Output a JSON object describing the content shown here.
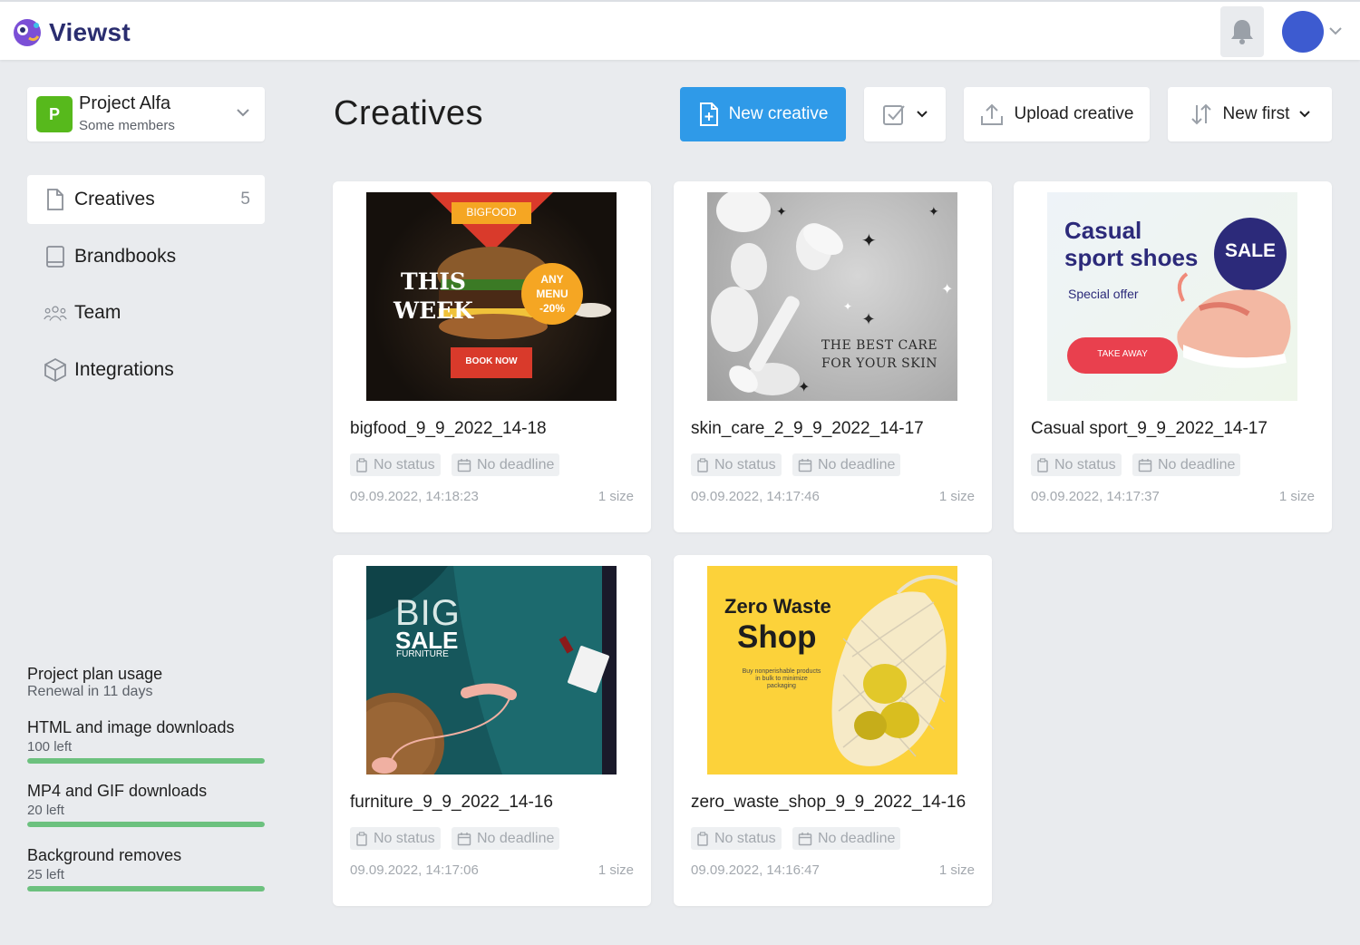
{
  "app": {
    "name": "Viewst"
  },
  "project": {
    "badge": "P",
    "name": "Project Alfa",
    "subtitle": "Some members"
  },
  "nav": {
    "items": [
      {
        "label": "Creatives",
        "count": "5",
        "icon": "file-icon"
      },
      {
        "label": "Brandbooks",
        "icon": "book-icon"
      },
      {
        "label": "Team",
        "icon": "team-icon"
      },
      {
        "label": "Integrations",
        "icon": "cube-icon"
      }
    ]
  },
  "usage": {
    "title": "Project plan usage",
    "renewal": "Renewal in 11 days",
    "items": [
      {
        "name": "HTML and image downloads",
        "left": "100 left",
        "fraction": 1.0
      },
      {
        "name": "MP4 and GIF downloads",
        "left": "20 left",
        "fraction": 1.0
      },
      {
        "name": "Background removes",
        "left": "25 left",
        "fraction": 1.0
      }
    ]
  },
  "header": {
    "title": "Creatives",
    "new_creative": "New creative",
    "upload_creative": "Upload creative",
    "sort": "New first"
  },
  "colors": {
    "primary": "#2f9ae8",
    "project_badge": "#57b91c",
    "avatar": "#3d5bd0",
    "usage_bar": "#6cc17e"
  },
  "cards": [
    {
      "name": "bigfood_9_9_2022_14-18",
      "status": "No status",
      "deadline": "No deadline",
      "date": "09.09.2022, 14:18:23",
      "size": "1 size",
      "thumb": {
        "banner": "BIGFOOD",
        "line1": "THIS",
        "line2": "WEEK",
        "badge1": "ANY",
        "badge2": "MENU",
        "badge3": "-20%",
        "cta": "BOOK NOW"
      }
    },
    {
      "name": "skin_care_2_9_9_2022_14-17",
      "status": "No status",
      "deadline": "No deadline",
      "date": "09.09.2022, 14:17:46",
      "size": "1 size",
      "thumb": {
        "line1": "THE BEST CARE",
        "line2": "FOR YOUR SKIN"
      }
    },
    {
      "name": "Casual sport_9_9_2022_14-17",
      "status": "No status",
      "deadline": "No deadline",
      "date": "09.09.2022, 14:17:37",
      "size": "1 size",
      "thumb": {
        "line1": "Casual",
        "line2": "sport shoes",
        "sale": "SALE",
        "offer": "Special offer",
        "cta": "TAKE AWAY"
      }
    },
    {
      "name": "furniture_9_9_2022_14-16",
      "status": "No status",
      "deadline": "No deadline",
      "date": "09.09.2022, 14:17:06",
      "size": "1 size",
      "thumb": {
        "line1": "BIG",
        "line2": "SALE",
        "line3": "FURNITURE"
      }
    },
    {
      "name": "zero_waste_shop_9_9_2022_14-16",
      "status": "No status",
      "deadline": "No deadline",
      "date": "09.09.2022, 14:16:47",
      "size": "1 size",
      "thumb": {
        "line1": "Zero Waste",
        "line2": "Shop",
        "small1": "Buy nonperishable products",
        "small2": "in bulk to minimize",
        "small3": "packaging"
      }
    }
  ]
}
